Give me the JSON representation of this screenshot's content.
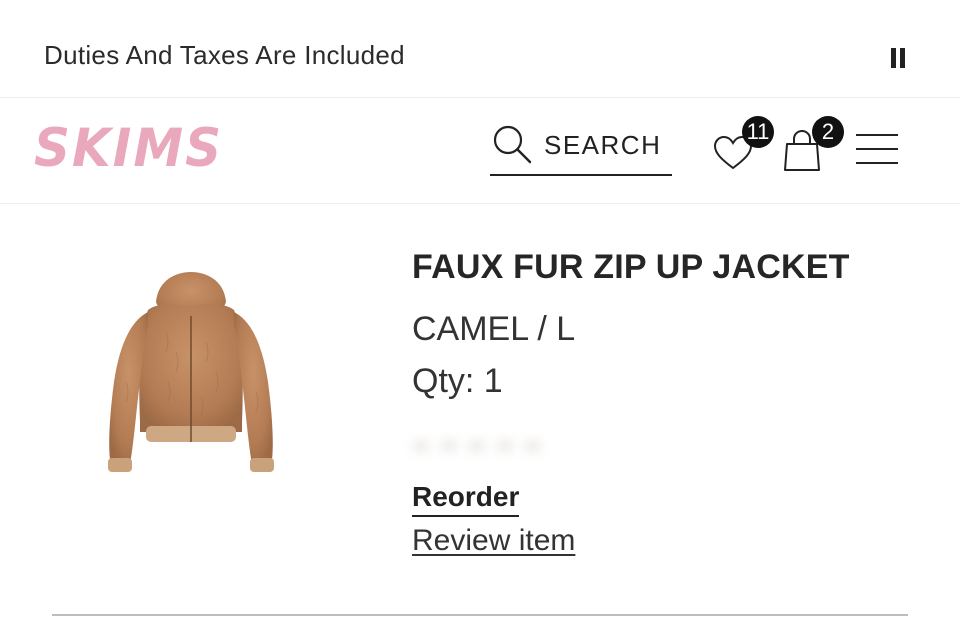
{
  "announcement": {
    "text": "Duties And Taxes Are Included",
    "pause_icon": "pause-icon"
  },
  "header": {
    "logo": "SKIMS",
    "logo_color": "#eaa8bd",
    "search_label": "SEARCH",
    "search_icon": "search-icon",
    "wishlist_icon": "heart-icon",
    "wishlist_count": "11",
    "bag_icon": "shopping-bag-icon",
    "bag_count": "2",
    "menu_icon": "hamburger-menu-icon"
  },
  "product": {
    "image_icon": "faux-fur-jacket-image",
    "title": "FAUX FUR ZIP UP JACKET",
    "variant": "CAMEL / L",
    "quantity": "Qty: 1",
    "reorder_label": "Reorder",
    "review_label": "Review item"
  }
}
